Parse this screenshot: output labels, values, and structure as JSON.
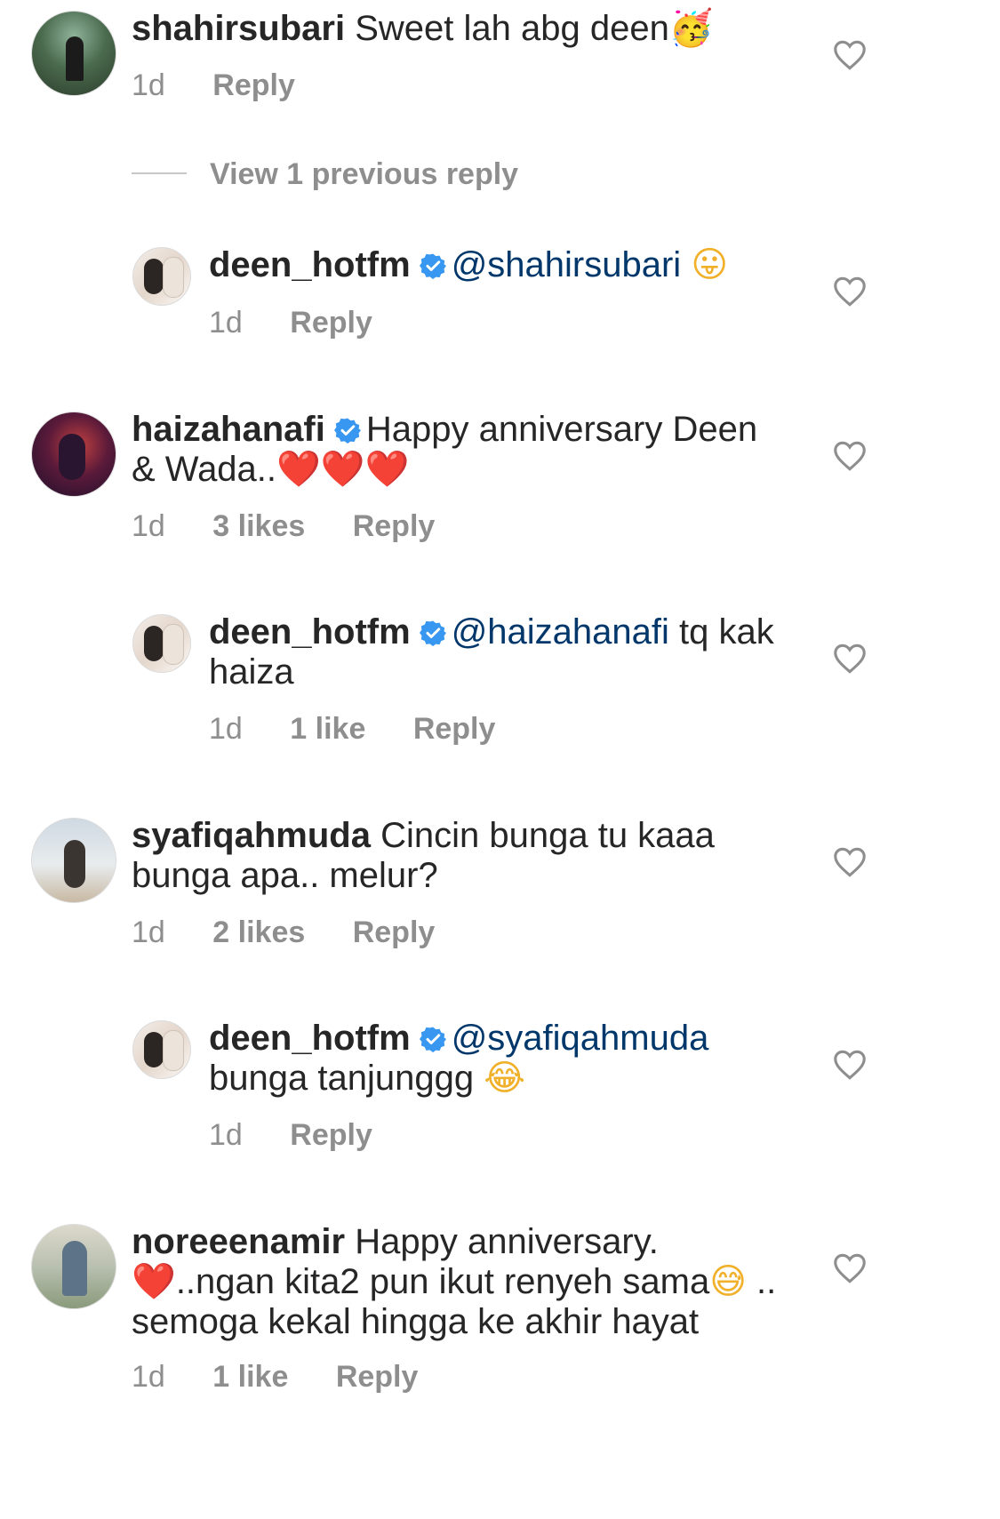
{
  "comments": [
    {
      "username": "shahirsubari",
      "text": "Sweet lah abg deen",
      "emoji": "🥳",
      "time": "1d",
      "likes": "",
      "reply": "Reply"
    },
    {
      "view_previous": "View 1 previous reply"
    },
    {
      "username": "deen_hotfm",
      "mention": "@shahirsubari",
      "text": "",
      "emoji": "😛",
      "time": "1d",
      "likes": "",
      "reply": "Reply"
    },
    {
      "username": "haizahanafi",
      "text_line1": "Happy anniversary Deen",
      "text_line2": "& Wada..",
      "emoji": "❤️❤️❤️",
      "time": "1d",
      "likes": "3 likes",
      "reply": "Reply"
    },
    {
      "username": "deen_hotfm",
      "mention": "@haizahanafi",
      "text_line1": " tq kak",
      "text_line2": "haiza",
      "time": "1d",
      "likes": "1 like",
      "reply": "Reply"
    },
    {
      "username": "syafiqahmuda",
      "text_line1": "Cincin bunga tu kaaa",
      "text_line2": "bunga apa.. melur?",
      "time": "1d",
      "likes": "2 likes",
      "reply": "Reply"
    },
    {
      "username": "deen_hotfm",
      "mention": "@syafiqahmuda",
      "text_line2": "bunga tanjunggg",
      "emoji": "😂",
      "time": "1d",
      "likes": "",
      "reply": "Reply"
    },
    {
      "username": "noreeenamir",
      "text_line1": "Happy anniversary.",
      "emoji_line2_start": "❤️",
      "text_line2": "..ngan kita2 pun ikut renyeh sama",
      "emoji_line2_end": "😅",
      "text_line2_tail": " ..",
      "text_line3": "semoga kekal hingga ke akhir hayat",
      "time": "1d",
      "likes": "1 like",
      "reply": "Reply"
    }
  ],
  "icons": {
    "heart": "heart-outline-icon",
    "verified": "verified-badge-icon"
  },
  "colors": {
    "text": "#262626",
    "meta": "#8e8e8e",
    "mention": "#00376b",
    "verified": "#3897f0"
  }
}
